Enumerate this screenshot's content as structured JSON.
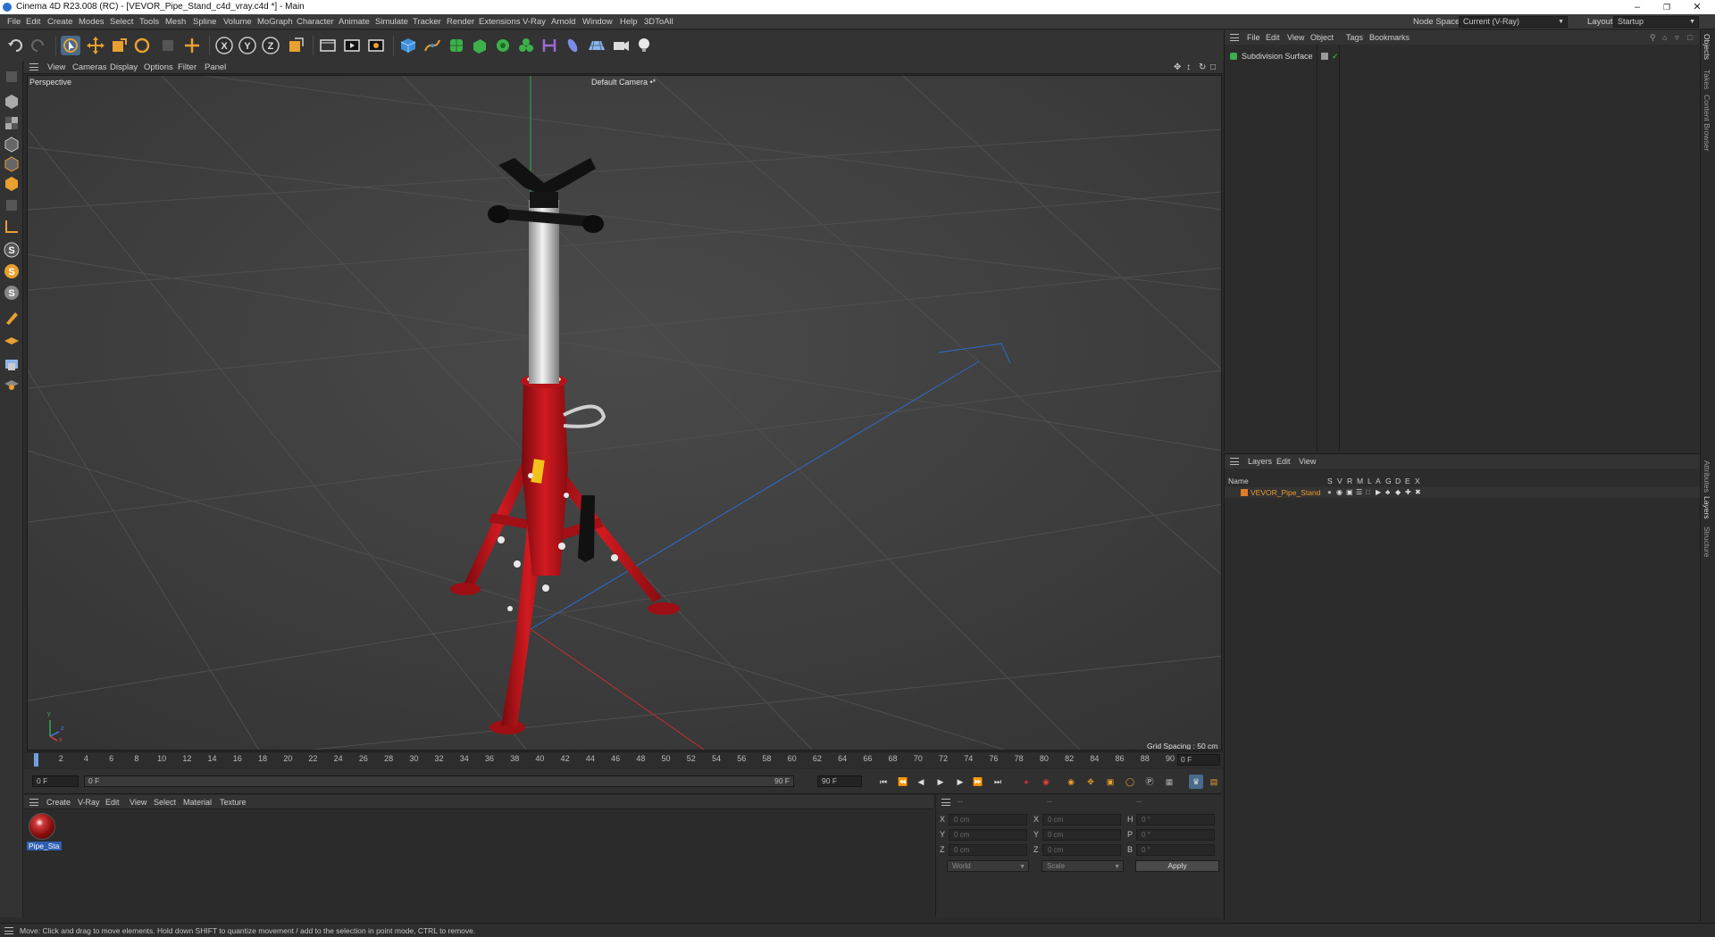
{
  "window": {
    "title": "Cinema 4D R23.008 (RC) - [VEVOR_Pipe_Stand_c4d_vray.c4d *] - Main",
    "minimize": "–",
    "maximize": "❐",
    "close": "✕"
  },
  "menubar": {
    "items": [
      "File",
      "Edit",
      "Create",
      "Modes",
      "Select",
      "Tools",
      "Mesh",
      "Spline",
      "Volume",
      "MoGraph",
      "Character",
      "Animate",
      "Simulate",
      "Tracker",
      "Render",
      "Extensions",
      "V-Ray",
      "Arnold",
      "Window",
      "Help",
      "3DToAll"
    ],
    "node_space_label": "Node Space:",
    "node_space_value": "Current (V-Ray)",
    "layout_label": "Layout:",
    "layout_value": "Startup"
  },
  "viewport": {
    "menu": [
      "View",
      "Cameras",
      "Display",
      "Options",
      "Filter",
      "Panel"
    ],
    "view_name": "Perspective",
    "camera_name": "Default Camera •*",
    "grid_spacing": "Grid Spacing : 50 cm",
    "axis_y": "y",
    "axis_z": "z",
    "axis_x": "x"
  },
  "timeline": {
    "ticks": [
      "0",
      "2",
      "4",
      "6",
      "8",
      "10",
      "12",
      "14",
      "16",
      "18",
      "20",
      "22",
      "24",
      "26",
      "28",
      "30",
      "32",
      "34",
      "36",
      "38",
      "40",
      "42",
      "44",
      "46",
      "48",
      "50",
      "52",
      "54",
      "56",
      "58",
      "60",
      "62",
      "64",
      "66",
      "68",
      "70",
      "72",
      "74",
      "76",
      "78",
      "80",
      "82",
      "84",
      "86",
      "88",
      "90"
    ],
    "current_frame": "0 F",
    "start_field": "0 F",
    "range_start": "0 F",
    "range_end": "90 F",
    "end_field": "90 F"
  },
  "material_manager": {
    "menu": [
      "Create",
      "V-Ray",
      "Edit",
      "View",
      "Select",
      "Material",
      "Texture"
    ],
    "material_name": "Pipe_Sta"
  },
  "coordinates": {
    "header_a": "--",
    "header_b": "--",
    "header_c": "--",
    "rows": [
      {
        "l1": "X",
        "v1": "0 cm",
        "l2": "X",
        "v2": "0 cm",
        "l3": "H",
        "v3": "0 °"
      },
      {
        "l1": "Y",
        "v1": "0 cm",
        "l2": "Y",
        "v2": "0 cm",
        "l3": "P",
        "v3": "0 °"
      },
      {
        "l1": "Z",
        "v1": "0 cm",
        "l2": "Z",
        "v2": "0 cm",
        "l3": "B",
        "v3": "0 °"
      }
    ],
    "space_dropdown": "World",
    "mode_dropdown": "Scale",
    "apply_label": "Apply"
  },
  "status": {
    "text": "Move: Click and drag to move elements. Hold down SHIFT to quantize movement / add to the selection in point mode, CTRL to remove."
  },
  "objects_panel": {
    "menu": [
      "File",
      "Edit",
      "View",
      "Object",
      "Tags",
      "Bookmarks"
    ],
    "object_name": "Subdivision Surface"
  },
  "layers_panel": {
    "menu": [
      "Layers",
      "Edit",
      "View"
    ],
    "name_header": "Name",
    "col_letters": [
      "S",
      "V",
      "R",
      "M",
      "L",
      "A",
      "G",
      "D",
      "E",
      "X"
    ],
    "layer_name": "VEVOR_Pipe_Stand",
    "layer_color": "#e07b2a"
  },
  "side_tabs": [
    "Objects",
    "Takes",
    "Content Browser",
    "Attributes",
    "Layers",
    "Structure"
  ],
  "colors": {
    "stand_red": "#c0141a",
    "accent_orange": "#e89a2c",
    "selection_blue": "#2f5fb0"
  }
}
